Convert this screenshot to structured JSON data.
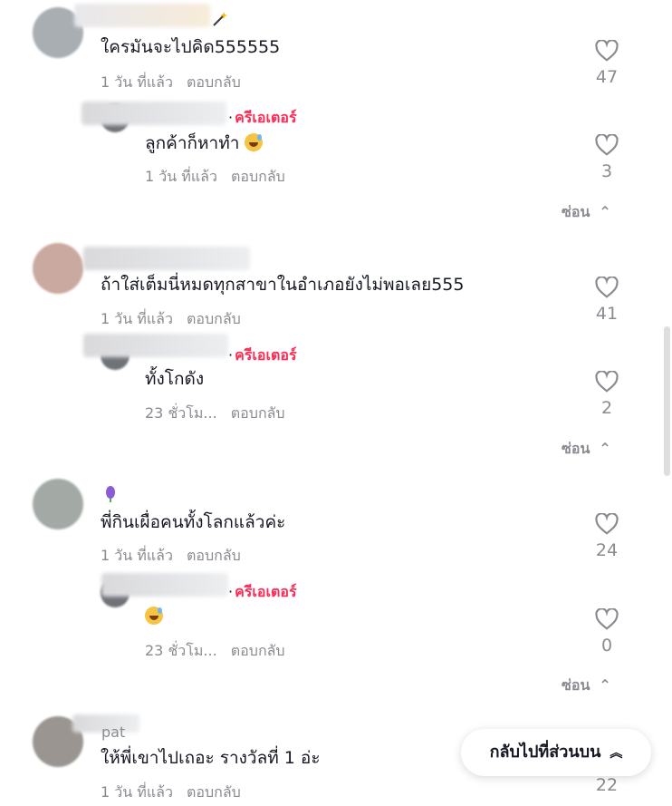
{
  "comments": [
    {
      "text": "ใครมันจะไปคิด555555",
      "time": "1 วัน ที่แล้ว",
      "reply_label": "ตอบกลับ",
      "likes": "47",
      "reply": {
        "creator_label": "ครีเอเตอร์",
        "text": "ลูกค้าก็หาทำ",
        "time": "1 วัน ที่แล้ว",
        "reply_label": "ตอบกลับ",
        "likes": "3"
      },
      "hide_label": "ซ่อน"
    },
    {
      "text": "ถ้าใส่เต็มนี่หมดทุกสาขาในอำเภอยังไม่พอเลย555",
      "time": "1 วัน ที่แล้ว",
      "reply_label": "ตอบกลับ",
      "likes": "41",
      "reply": {
        "creator_label": "ครีเอเตอร์",
        "text": "ทั้งโกดัง",
        "time": "23 ชั่วโม...",
        "reply_label": "ตอบกลับ",
        "likes": "2"
      },
      "hide_label": "ซ่อน"
    },
    {
      "text": "พี่กินเผื่อคนทั้งโลกแล้วค่ะ",
      "time": "1 วัน ที่แล้ว",
      "reply_label": "ตอบกลับ",
      "likes": "24",
      "reply": {
        "creator_label": "ครีเอเตอร์",
        "text": "",
        "time": "23 ชั่วโม...",
        "reply_label": "ตอบกลับ",
        "likes": "0"
      },
      "hide_label": "ซ่อน"
    },
    {
      "username": "pat",
      "text": "ให้พี่เขาไปเถอะ รางวัลที่ 1 อ่ะ",
      "time": "1 วัน ที่แล้ว",
      "reply_label": "ตอบกลับ",
      "likes": "22"
    }
  ],
  "back_to_top_label": "กลับไปที่ส่วนบน",
  "colors": {
    "accent": "#fe2c55",
    "muted": "#8a8b91",
    "text": "#161823"
  }
}
